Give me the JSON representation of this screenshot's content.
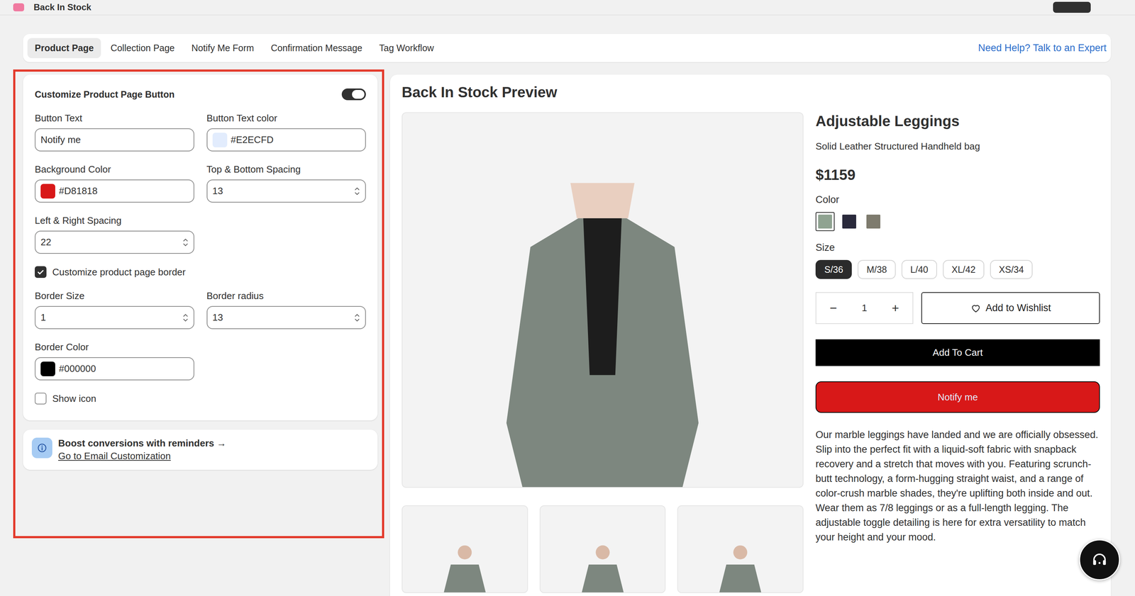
{
  "app": {
    "title": "Back In Stock"
  },
  "tabs": [
    {
      "label": "Product Page",
      "selected": true
    },
    {
      "label": "Collection Page",
      "selected": false
    },
    {
      "label": "Notify Me Form",
      "selected": false
    },
    {
      "label": "Confirmation Message",
      "selected": false
    },
    {
      "label": "Tag Workflow",
      "selected": false
    }
  ],
  "help_link": "Need Help? Talk to an Expert",
  "settings": {
    "title": "Customize Product Page Button",
    "enabled": true,
    "rows": [
      [
        {
          "kind": "text",
          "label": "Button Text",
          "value": "Notify me"
        },
        {
          "kind": "color",
          "label": "Button Text color",
          "value": "#E2ECFD"
        }
      ],
      [
        {
          "kind": "color",
          "label": "Background Color",
          "value": "#D81818"
        },
        {
          "kind": "number",
          "label": "Top & Bottom Spacing",
          "value": "13"
        }
      ],
      [
        {
          "kind": "number",
          "label": "Left & Right Spacing",
          "value": "22"
        }
      ],
      [
        {
          "kind": "checkbox",
          "label": "Customize product page border",
          "checked": true
        }
      ],
      [
        {
          "kind": "number",
          "label": "Border Size",
          "value": "1"
        },
        {
          "kind": "number",
          "label": "Border radius",
          "value": "13"
        }
      ],
      [
        {
          "kind": "color",
          "label": "Border Color",
          "value": "#000000"
        }
      ],
      [
        {
          "kind": "checkbox",
          "label": "Show icon",
          "checked": false
        }
      ]
    ]
  },
  "info": {
    "title": "Boost conversions with reminders →",
    "link": "Go to Email Customization"
  },
  "preview": {
    "title": "Back In Stock Preview",
    "product": {
      "name": "Adjustable Leggings",
      "subtitle": "Solid Leather Structured Handheld bag",
      "price": "$1159",
      "color_label": "Color",
      "colors": [
        {
          "color": "#8fa391",
          "selected": true
        },
        {
          "color": "#2a2a3c",
          "selected": false
        },
        {
          "color": "#7e7b6e",
          "selected": false
        }
      ],
      "size_label": "Size",
      "sizes": [
        {
          "label": "S/36",
          "selected": true
        },
        {
          "label": "M/38",
          "selected": false
        },
        {
          "label": "L/40",
          "selected": false
        },
        {
          "label": "XL/42",
          "selected": false
        },
        {
          "label": "XS/34",
          "selected": false
        }
      ],
      "quantity": {
        "minus": "−",
        "value": "1",
        "plus": "+"
      },
      "wishlist": "Add to Wishlist",
      "add_to_cart": "Add To Cart",
      "description": "Our marble leggings have landed and we are officially obsessed. Slip into the perfect fit with a liquid-soft fabric with snapback recovery and a stretch that moves with you. Featuring scrunch-butt technology, a form-hugging straight waist, and a range of color-crush marble shades, they're uplifting both inside and out. Wear them as 7/8 leggings or as a full-length legging. The adjustable toggle detailing is here for extra versatility to match your height and your mood."
    }
  }
}
